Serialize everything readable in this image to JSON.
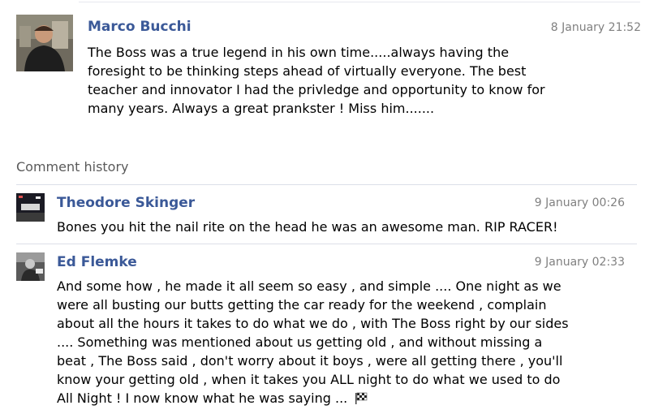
{
  "post": {
    "author": "Marco Bucchi",
    "timestamp": "8 January 21:52",
    "text_lines": [
      "The Boss was a true legend in his own time.....always having the",
      "foresight to be thinking steps ahead of virtually everyone. The best",
      "teacher and innovator I had the privledge and opportunity to know for",
      "many years. Always a great prankster ! Miss him......."
    ]
  },
  "history": {
    "label": "Comment history",
    "comments": [
      {
        "author": "Theodore Skinger",
        "timestamp": "9 January 00:26",
        "text_lines": [
          "Bones you hit the nail rite on the head he was an awesome man. RIP RACER!"
        ]
      },
      {
        "author": "Ed Flemke",
        "timestamp": "9 January 02:33",
        "text_lines": [
          "And some how , he made it all seem so easy , and simple .... One night as we",
          "were all busting our butts getting the car ready for the weekend , complain",
          "about all the hours it takes to do what we do , with The Boss right by our sides",
          ".... Something was mentioned about us getting old , and without missing a",
          "beat , The Boss said , don't worry about it boys , were all getting there , you'll",
          "know your getting old , when it takes you ALL night to do what we used to do",
          "All Night ! I now know what he was saying ..."
        ],
        "trailing_icon": "checkered-flag-icon"
      }
    ]
  },
  "colors": {
    "link": "#3b5998",
    "timestamp": "#808080",
    "divider": "#dcdfe8"
  }
}
